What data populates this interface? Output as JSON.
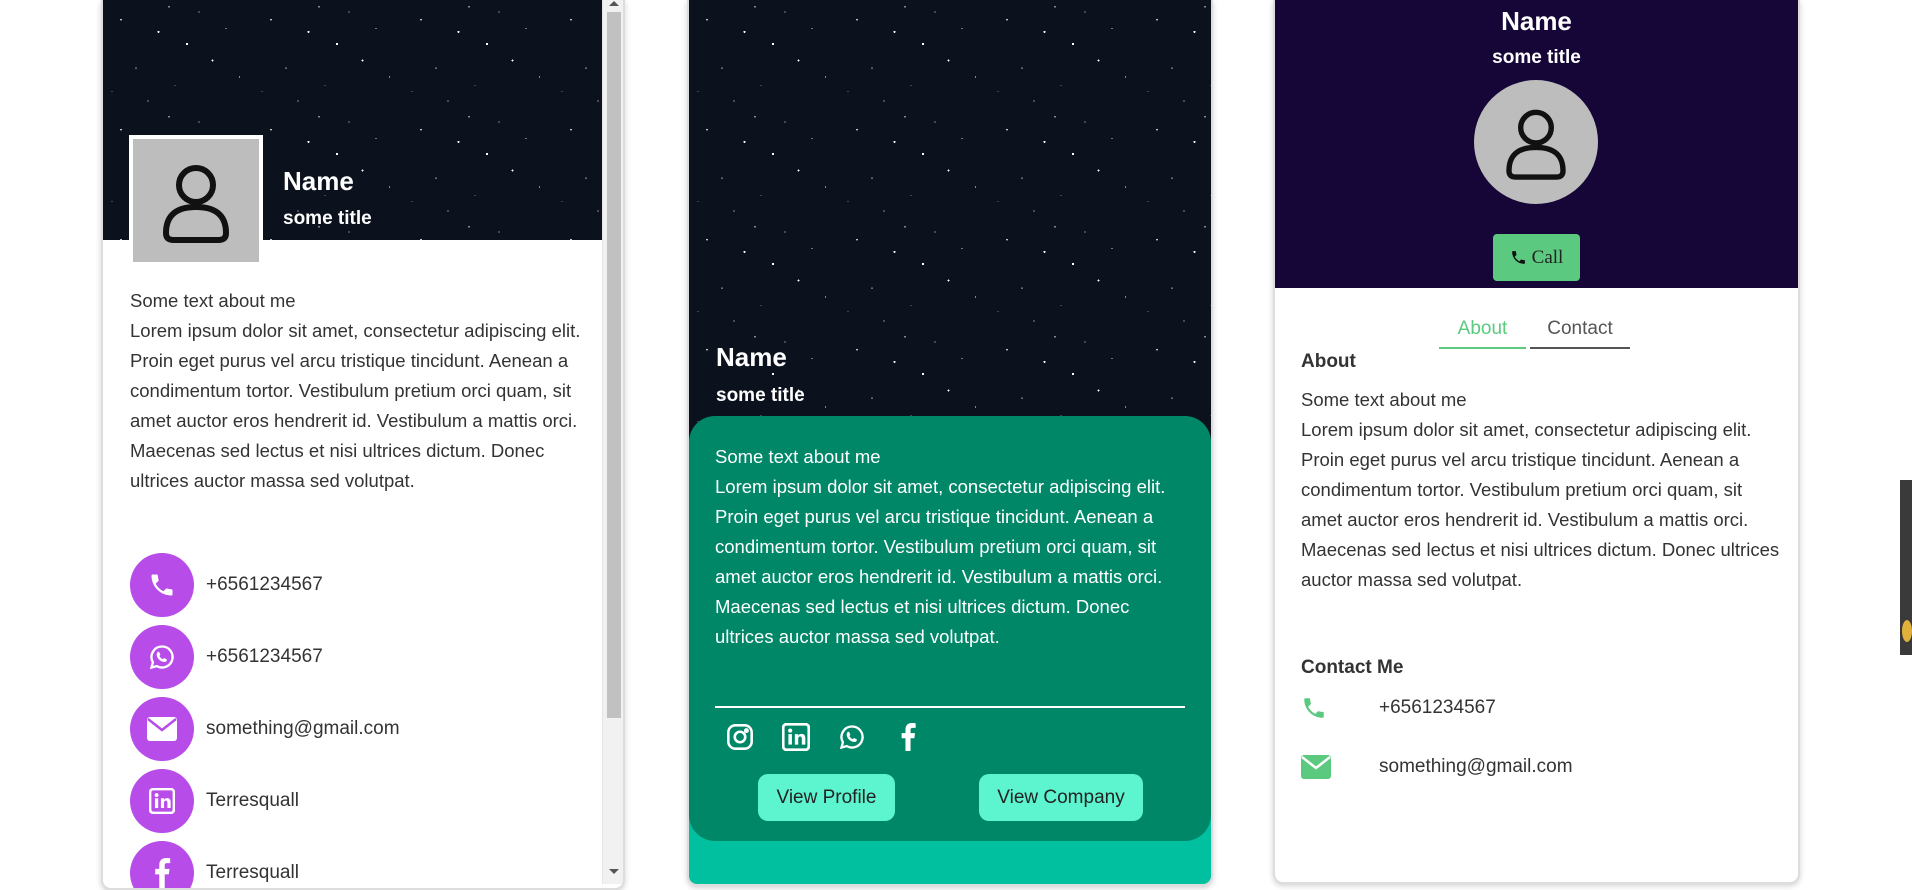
{
  "card1": {
    "name": "Name",
    "title": "some title",
    "about_heading": "Some text about me",
    "about_text": "Lorem ipsum dolor sit amet, consectetur adipiscing elit. Proin eget purus vel arcu tristique tincidunt. Aenean a condimentum tortor. Vestibulum pretium orci quam, sit amet auctor eros hendrerit id. Vestibulum a mattis orci. Maecenas sed lectus et nisi ultrices dictum. Donec ultrices auctor massa sed volutpat.",
    "contacts": [
      {
        "icon": "phone-icon",
        "text": "+6561234567"
      },
      {
        "icon": "whatsapp-icon",
        "text": "+6561234567"
      },
      {
        "icon": "envelope-icon",
        "text": "something@gmail.com"
      },
      {
        "icon": "linkedin-icon",
        "text": "Terresquall"
      },
      {
        "icon": "facebook-icon",
        "text": "Terresquall"
      }
    ],
    "accent_color": "#b84ce8"
  },
  "card2": {
    "name": "Name",
    "title": "some title",
    "about_heading": "Some text about me",
    "about_text": "Lorem ipsum dolor sit amet, consectetur adipiscing elit. Proin eget purus vel arcu tristique tincidunt. Aenean a condimentum tortor. Vestibulum pretium orci quam, sit amet auctor eros hendrerit id. Vestibulum a mattis orci. Maecenas sed lectus et nisi ultrices dictum. Donec ultrices auctor massa sed volutpat.",
    "socials": [
      "instagram-icon",
      "linkedin-icon",
      "whatsapp-icon",
      "facebook-icon"
    ],
    "view_profile_label": "View Profile",
    "view_company_label": "View Company",
    "panel_color": "#008768",
    "button_color": "#5cf5cf"
  },
  "card3": {
    "name": "Name",
    "title": "some title",
    "call_label": "Call",
    "tabs": [
      {
        "label": "About",
        "active": true
      },
      {
        "label": "Contact",
        "active": false
      }
    ],
    "about_title": "About",
    "about_heading": "Some text about me",
    "about_text": "Lorem ipsum dolor sit amet, consectetur adipiscing elit. Proin eget purus vel arcu tristique tincidunt. Aenean a condimentum tortor. Vestibulum pretium orci quam, sit amet auctor eros hendrerit id. Vestibulum a mattis orci. Maecenas sed lectus et nisi ultrices dictum. Donec ultrices auctor massa sed volutpat.",
    "contact_title": "Contact Me",
    "contacts": [
      {
        "icon": "phone-icon",
        "text": "+6561234567"
      },
      {
        "icon": "envelope-icon",
        "text": "something@gmail.com"
      }
    ],
    "header_color": "#150637",
    "accent_color": "#5bc97f"
  }
}
